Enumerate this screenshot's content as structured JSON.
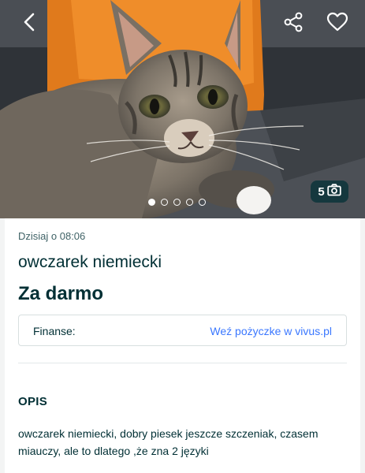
{
  "listing": {
    "date": "Dzisiaj o 08:06",
    "title": "owczarek niemiecki",
    "price": "Za darmo"
  },
  "gallery": {
    "photo_count": "5",
    "dots_total": 5,
    "dots_active": 1
  },
  "finance": {
    "label": "Finanse:",
    "link_text": "Weź pożyczke w vivus.pl"
  },
  "description": {
    "heading": "OPIS",
    "text": "owczarek niemiecki, dobry piesek jeszcze szczeniak, czasem miauczy, ale to dlatego ,że zna 2 języki"
  },
  "icons": {
    "back": "chevron-left-icon",
    "share": "share-icon",
    "favorite": "heart-icon",
    "camera": "camera-icon"
  },
  "colors": {
    "text_primary": "#002f34",
    "link": "#3a77ff",
    "page_background": "#f3f4f4"
  }
}
